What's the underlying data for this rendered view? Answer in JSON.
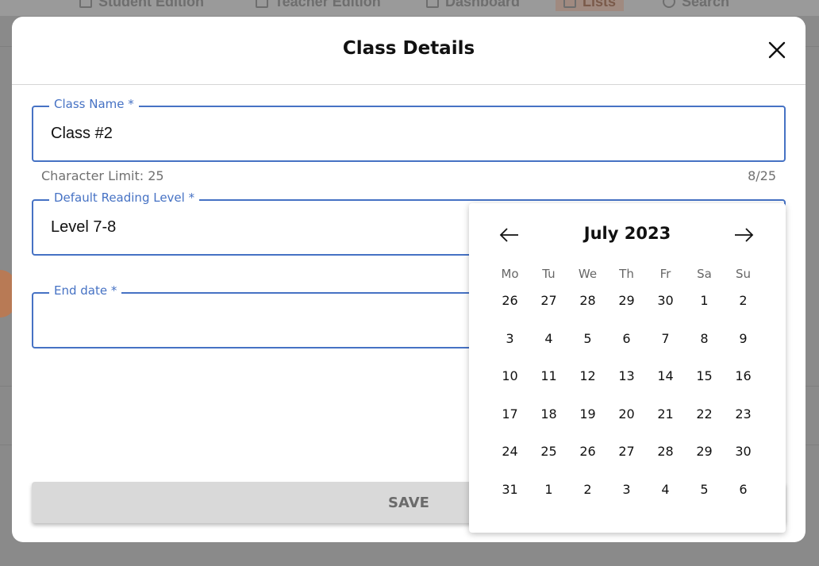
{
  "background": {
    "nav": [
      {
        "label": "Student Edition",
        "active": false
      },
      {
        "label": "Teacher Edition",
        "active": false
      },
      {
        "label": "Dashboard",
        "active": false
      },
      {
        "label": "Lists",
        "active": true
      },
      {
        "label": "Search",
        "active": false
      }
    ]
  },
  "modal": {
    "title": "Class Details",
    "close_icon": "close-icon"
  },
  "form": {
    "class_name": {
      "label": "Class Name *",
      "value": "Class #2"
    },
    "helper_left": "Character Limit: 25",
    "helper_right": "8/25",
    "reading_level": {
      "label": "Default Reading Level *",
      "value": "Level 7-8"
    },
    "end_date": {
      "label": "End date *",
      "value": ""
    },
    "save_label": "SAVE"
  },
  "calendar": {
    "month_label": "July 2023",
    "prev_icon": "arrow-left-icon",
    "next_icon": "arrow-right-icon",
    "weekdays": [
      "Mo",
      "Tu",
      "We",
      "Th",
      "Fr",
      "Sa",
      "Su"
    ],
    "days": [
      "26",
      "27",
      "28",
      "29",
      "30",
      "1",
      "2",
      "3",
      "4",
      "5",
      "6",
      "7",
      "8",
      "9",
      "10",
      "11",
      "12",
      "13",
      "14",
      "15",
      "16",
      "17",
      "18",
      "19",
      "20",
      "21",
      "22",
      "23",
      "24",
      "25",
      "26",
      "27",
      "28",
      "29",
      "30",
      "31",
      "1",
      "2",
      "3",
      "4",
      "5",
      "6"
    ]
  }
}
